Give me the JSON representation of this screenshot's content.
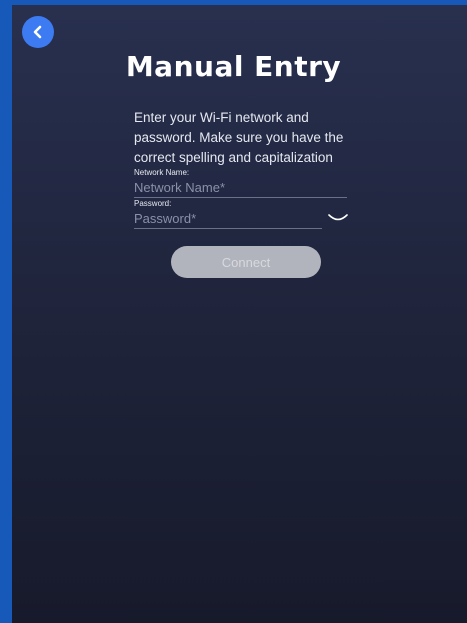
{
  "header": {
    "title": "Manual Entry"
  },
  "instructions": "Enter your Wi-Fi network and password. Make sure you have the correct spelling and capitalization",
  "form": {
    "network_label": "Network Name:",
    "network_placeholder": "Network Name*",
    "password_label": "Password:",
    "password_placeholder": "Password*",
    "connect_label": "Connect"
  },
  "icons": {
    "back": "chevron-left-icon",
    "password_toggle": "eye-closed-icon"
  },
  "colors": {
    "accent": "#3d7bf2",
    "frame": "#1659b8",
    "button_disabled": "#b2b4bd"
  }
}
